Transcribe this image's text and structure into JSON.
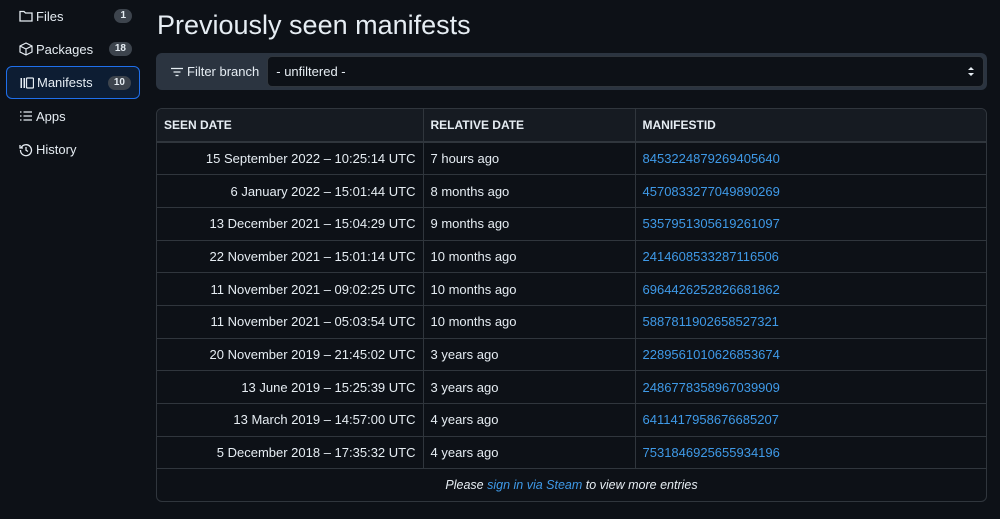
{
  "sidebar": {
    "items": [
      {
        "label": "Files",
        "icon": "folder-icon",
        "badge": "1"
      },
      {
        "label": "Packages",
        "icon": "package-icon",
        "badge": "18"
      },
      {
        "label": "Manifests",
        "icon": "manifests-icon",
        "badge": "10",
        "active": true
      },
      {
        "label": "Apps",
        "icon": "list-icon"
      },
      {
        "label": "History",
        "icon": "history-icon"
      }
    ]
  },
  "page": {
    "title": "Previously seen manifests"
  },
  "filter": {
    "label": "Filter branch",
    "selected": "- unfiltered -"
  },
  "table": {
    "headers": [
      "SEEN DATE",
      "RELATIVE DATE",
      "MANIFESTID"
    ],
    "rows": [
      {
        "seen": "15 September 2022 – 10:25:14 UTC",
        "relative": "7 hours ago",
        "id": "8453224879269405640"
      },
      {
        "seen": "6 January 2022 – 15:01:44 UTC",
        "relative": "8 months ago",
        "id": "4570833277049890269"
      },
      {
        "seen": "13 December 2021 – 15:04:29 UTC",
        "relative": "9 months ago",
        "id": "5357951305619261097"
      },
      {
        "seen": "22 November 2021 – 15:01:14 UTC",
        "relative": "10 months ago",
        "id": "2414608533287116506"
      },
      {
        "seen": "11 November 2021 – 09:02:25 UTC",
        "relative": "10 months ago",
        "id": "6964426252826681862"
      },
      {
        "seen": "11 November 2021 – 05:03:54 UTC",
        "relative": "10 months ago",
        "id": "5887811902658527321"
      },
      {
        "seen": "20 November 2019 – 21:45:02 UTC",
        "relative": "3 years ago",
        "id": "2289561010626853674"
      },
      {
        "seen": "13 June 2019 – 15:25:39 UTC",
        "relative": "3 years ago",
        "id": "2486778358967039909"
      },
      {
        "seen": "13 March 2019 – 14:57:00 UTC",
        "relative": "4 years ago",
        "id": "6411417958676685207"
      },
      {
        "seen": "5 December 2018 – 17:35:32 UTC",
        "relative": "4 years ago",
        "id": "7531846925655934196"
      }
    ],
    "footer": {
      "before": "Please ",
      "link": "sign in via Steam",
      "after": " to view more entries"
    }
  },
  "colors": {
    "background": "#0d1117",
    "link": "#3f9ae8",
    "active_border": "#1f6feb"
  }
}
